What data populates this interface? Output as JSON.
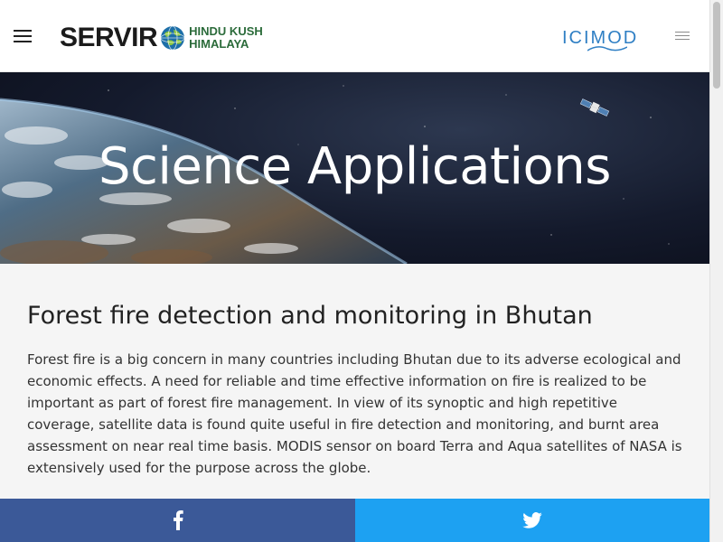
{
  "header": {
    "menu_icon": "hamburger-menu-icon",
    "logo": {
      "word": "SERVIR",
      "sub_line1": "HINDU KUSH",
      "sub_line2": "HIMALAYA",
      "globe_icon": "globe-icon"
    },
    "partner_logo": "ICIMOD",
    "secondary_menu_icon": "list-menu-icon"
  },
  "hero": {
    "title": "Science Applications",
    "satellite_icon": "satellite-icon"
  },
  "article": {
    "heading": "Forest fire detection and monitoring in Bhutan",
    "body": "Forest fire is a big concern in many countries including Bhutan due to its adverse ecological and economic effects. A need for reliable and time effective information on fire is realized to be important as part of forest fire management. In view of its synoptic and high repetitive coverage, satellite data is found quite useful in fire detection and monitoring, and burnt area assessment on near real time basis. MODIS sensor on board Terra and Aqua satellites of NASA is extensively used for the purpose across the globe."
  },
  "share": {
    "facebook_icon": "facebook-icon",
    "twitter_icon": "twitter-icon"
  },
  "colors": {
    "facebook": "#3b5998",
    "twitter": "#1da1f2",
    "icimod_blue": "#2f7fc4",
    "logo_green": "#2b6b3a"
  }
}
